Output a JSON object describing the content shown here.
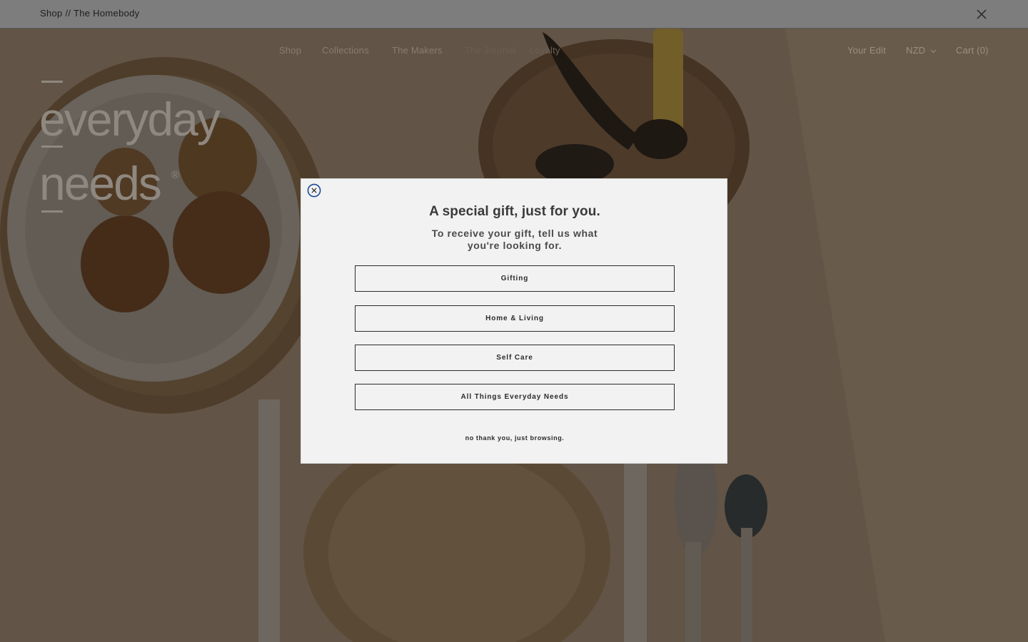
{
  "announcement": {
    "text": "Shop // The Homebody",
    "close_icon": "close-icon"
  },
  "nav": {
    "items": [
      {
        "label": "Shop"
      },
      {
        "label": "Collections"
      },
      {
        "label": "The Makers"
      },
      {
        "label": "The Journal"
      },
      {
        "label": "Loyalty"
      }
    ],
    "your_edit": "Your Edit",
    "currency": "NZD",
    "cart": "Cart (0)"
  },
  "logo": {
    "line1": "everyday",
    "line2": "needs",
    "mark": "®"
  },
  "modal": {
    "title": "A special gift, just for you.",
    "subtitle": "To receive your gift, tell us what you're looking for.",
    "options": [
      {
        "label": "Gifting"
      },
      {
        "label": "Home & Living"
      },
      {
        "label": "Self Care"
      },
      {
        "label": "All Things Everyday Needs"
      }
    ],
    "decline": "no thank you, just browsing.",
    "close_icon": "circle-close-icon",
    "accent": "#1a4a9a"
  }
}
